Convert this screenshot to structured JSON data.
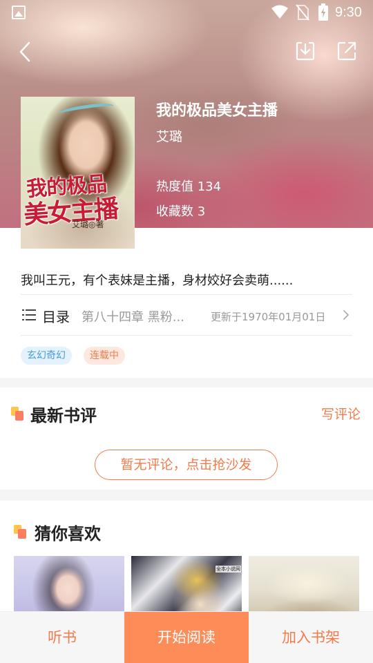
{
  "status_bar": {
    "time": "9:30",
    "icons": [
      "photo-icon",
      "wifi-icon",
      "no-sim-icon",
      "battery-icon"
    ]
  },
  "nav": {
    "icons": [
      "back-arrow-icon",
      "download-icon",
      "share-icon"
    ]
  },
  "book": {
    "cover_text": {
      "title_line_1": "我的极品",
      "title_line_2": "美女主播",
      "author": "艾璐◎著"
    },
    "title": "我的极品美女主播",
    "author": "艾璐",
    "heat": "热度值 134",
    "favorites": "收藏数 3",
    "synopsis": "我叫王元，有个表妹是主播，身材姣好会卖萌......",
    "toc": {
      "label": "目录",
      "latest_chapter": "第八十四章 黑粉...",
      "updated": "更新于1970年01月01日"
    },
    "tags": [
      "玄幻奇幻",
      "连载中"
    ]
  },
  "reviews": {
    "title": "最新书评",
    "write_label": "写评论",
    "empty_label": "暂无评论，点击抢沙发"
  },
  "recommend": {
    "title": "猜你喜欢",
    "books": [
      {
        "cover_text": ""
      },
      {
        "cover_text": "全本小说网"
      },
      {
        "cover_text": ""
      }
    ]
  },
  "bottom_bar": {
    "listen_label": "听书",
    "read_label": "开始阅读",
    "shelf_label": "加入书架"
  },
  "colors": {
    "accent": "#f27b4c",
    "primary_button": "#fd8c58",
    "tag_genre_bg": "#e3f2fc",
    "tag_genre_text": "#4a9bd6",
    "tag_status_bg": "#fde8df"
  }
}
